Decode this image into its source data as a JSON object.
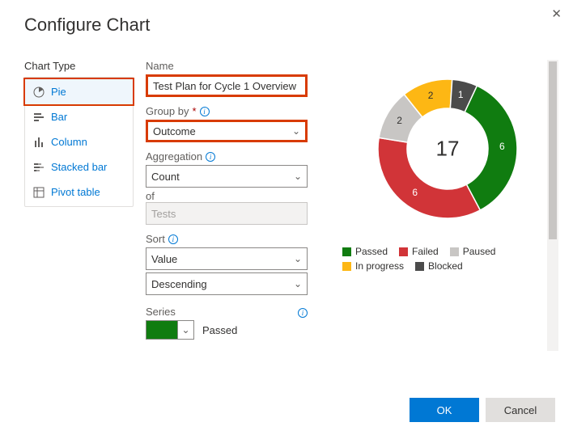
{
  "dialog": {
    "title": "Configure Chart",
    "ok_label": "OK",
    "cancel_label": "Cancel"
  },
  "chart_type": {
    "label": "Chart Type",
    "items": [
      "Pie",
      "Bar",
      "Column",
      "Stacked bar",
      "Pivot table"
    ],
    "selected": "Pie"
  },
  "form": {
    "name_label": "Name",
    "name_value": "Test Plan for Cycle 1 Overview",
    "groupby_label": "Group by",
    "groupby_value": "Outcome",
    "aggregation_label": "Aggregation",
    "aggregation_value": "Count",
    "of_label": "of",
    "of_value": "Tests",
    "sort_label": "Sort",
    "sort_field": "Value",
    "sort_dir": "Descending",
    "series_label": "Series",
    "series": [
      {
        "label": "Passed",
        "color": "#107c10"
      }
    ]
  },
  "legend": {
    "items": [
      {
        "label": "Passed",
        "color": "#107c10"
      },
      {
        "label": "Failed",
        "color": "#d13438"
      },
      {
        "label": "Paused",
        "color": "#c8c6c4"
      },
      {
        "label": "In progress",
        "color": "#fdb714"
      },
      {
        "label": "Blocked",
        "color": "#4b4b4b"
      }
    ]
  },
  "chart_data": {
    "type": "pie",
    "title": "Test Plan for Cycle 1 Overview",
    "total": 17,
    "series": [
      {
        "name": "Passed",
        "value": 6,
        "color": "#107c10"
      },
      {
        "name": "Failed",
        "value": 6,
        "color": "#d13438"
      },
      {
        "name": "Paused",
        "value": 2,
        "color": "#c8c6c4"
      },
      {
        "name": "In progress",
        "value": 2,
        "color": "#fdb714"
      },
      {
        "name": "Blocked",
        "value": 1,
        "color": "#4b4b4b"
      }
    ]
  }
}
